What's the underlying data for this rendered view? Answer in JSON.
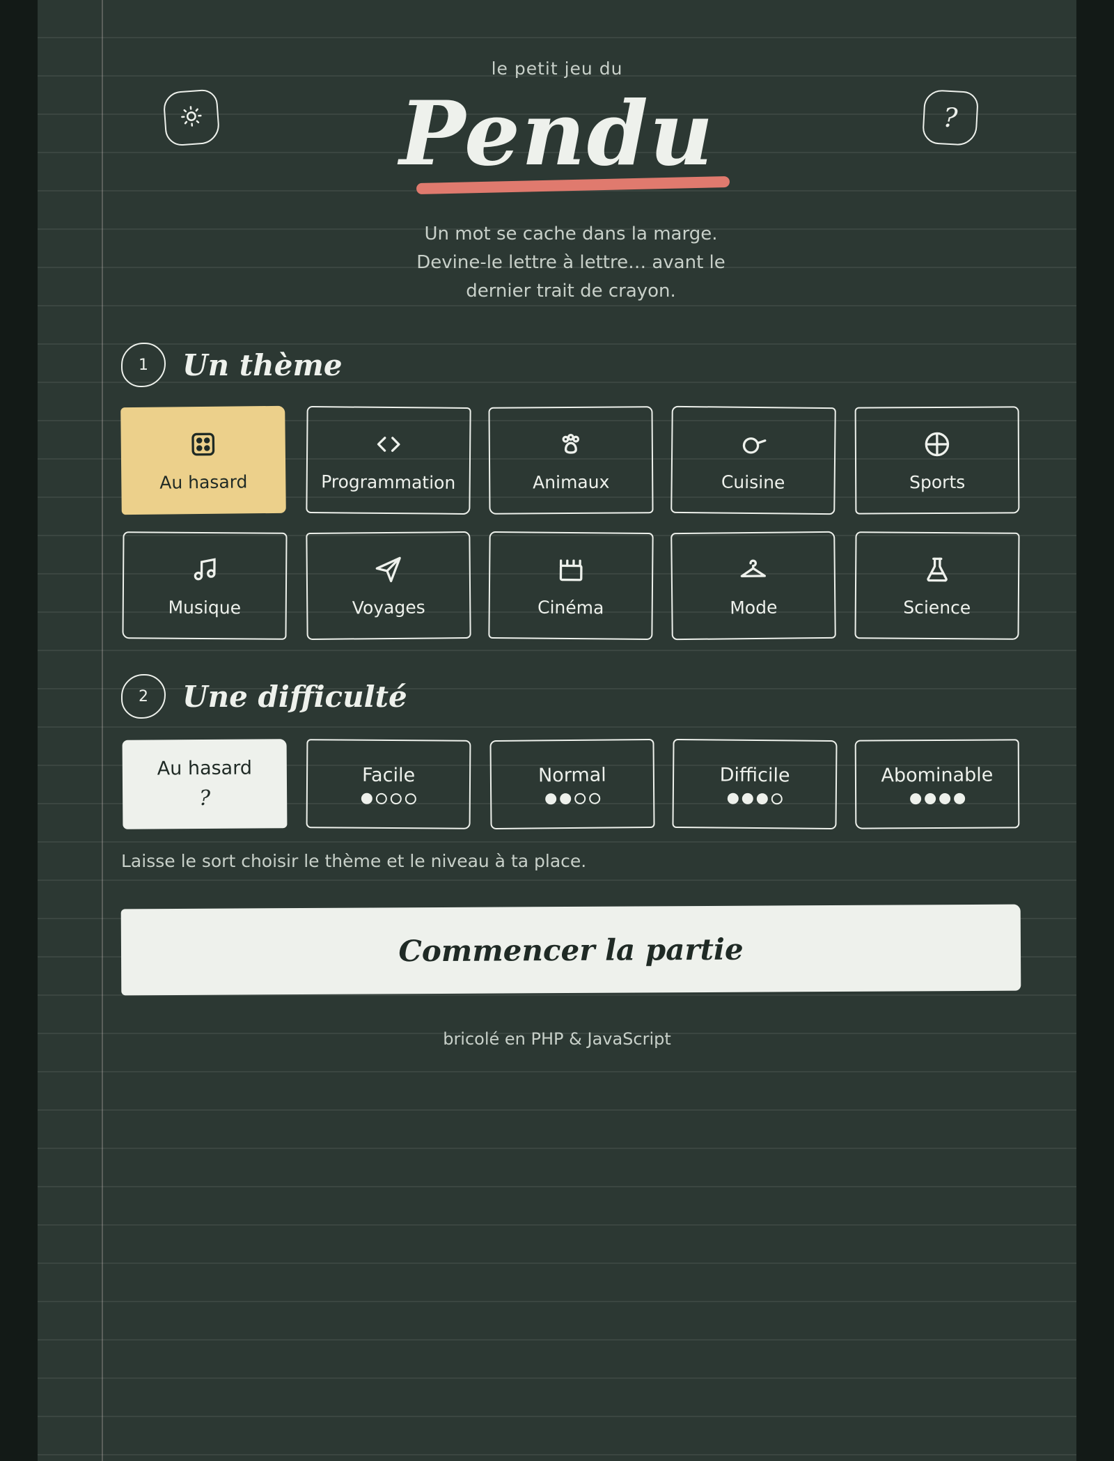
{
  "header": {
    "eyebrow": "le petit jeu du",
    "title": "Pendu",
    "tagline": "Un mot se cache dans la marge. Devine-le lettre à lettre… avant le dernier trait de crayon.",
    "theme_toggle_icon": "sun-icon",
    "help_label": "?"
  },
  "colors": {
    "paper": "#2c3833",
    "accent_yellow": "#ecd08b",
    "underline_red": "#e07a6e",
    "ink": "#eef1ec"
  },
  "themes_section": {
    "number": "1",
    "title": "Un thème",
    "items": [
      {
        "label": "Au hasard",
        "icon": "dice-icon",
        "selected": true
      },
      {
        "label": "Programmation",
        "icon": "code-icon",
        "selected": false
      },
      {
        "label": "Animaux",
        "icon": "paw-icon",
        "selected": false
      },
      {
        "label": "Cuisine",
        "icon": "pan-icon",
        "selected": false
      },
      {
        "label": "Sports",
        "icon": "ball-icon",
        "selected": false
      },
      {
        "label": "Musique",
        "icon": "music-icon",
        "selected": false
      },
      {
        "label": "Voyages",
        "icon": "paper-plane-icon",
        "selected": false
      },
      {
        "label": "Cinéma",
        "icon": "clapperboard-icon",
        "selected": false
      },
      {
        "label": "Mode",
        "icon": "hanger-icon",
        "selected": false
      },
      {
        "label": "Science",
        "icon": "flask-icon",
        "selected": false
      }
    ]
  },
  "difficulty_section": {
    "number": "2",
    "title": "Une difficulté",
    "items": [
      {
        "label": "Au hasard",
        "symbol": "?",
        "level": null,
        "selected": true
      },
      {
        "label": "Facile",
        "level": 1,
        "max": 4,
        "selected": false
      },
      {
        "label": "Normal",
        "level": 2,
        "max": 4,
        "selected": false
      },
      {
        "label": "Difficile",
        "level": 3,
        "max": 4,
        "selected": false
      },
      {
        "label": "Abominable",
        "level": 4,
        "max": 4,
        "selected": false
      }
    ],
    "hint": "Laisse le sort choisir le thème et le niveau à ta place."
  },
  "start_button": {
    "label": "Commencer la partie"
  },
  "footer": {
    "text": "bricolé en PHP & JavaScript"
  }
}
